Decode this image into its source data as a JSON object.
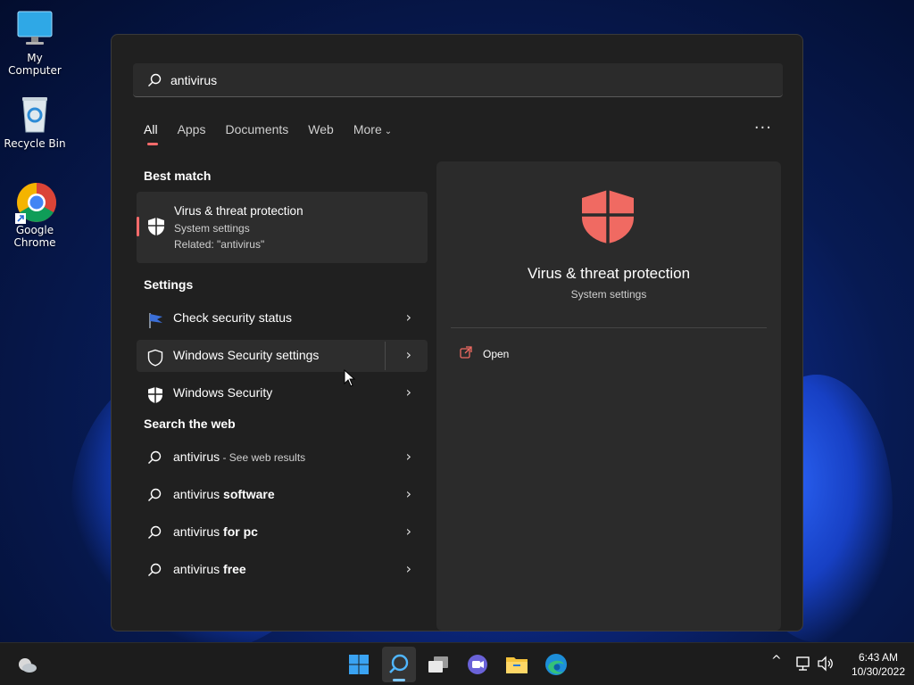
{
  "desktop": {
    "icons": [
      {
        "label": "My Computer"
      },
      {
        "label": "Recycle Bin"
      },
      {
        "label": "Google Chrome"
      }
    ]
  },
  "search": {
    "query": "antivirus",
    "tabs": [
      "All",
      "Apps",
      "Documents",
      "Web",
      "More"
    ],
    "active_tab": "All"
  },
  "best_match": {
    "heading": "Best match",
    "title": "Virus & threat protection",
    "subtitle": "System settings",
    "related": "Related: \"antivirus\""
  },
  "settings": {
    "heading": "Settings",
    "items": [
      {
        "label": "Check security status",
        "icon": "flag-icon"
      },
      {
        "label": "Windows Security settings",
        "icon": "shield-outline-icon"
      },
      {
        "label": "Windows Security",
        "icon": "shield-filled-icon"
      }
    ]
  },
  "web": {
    "heading": "Search the web",
    "items": [
      {
        "prefix": "antivirus",
        "suffix": " - See web results",
        "bold": ""
      },
      {
        "prefix": "antivirus ",
        "bold": "software",
        "suffix": ""
      },
      {
        "prefix": "antivirus ",
        "bold": "for pc",
        "suffix": ""
      },
      {
        "prefix": "antivirus ",
        "bold": "free",
        "suffix": ""
      }
    ]
  },
  "detail": {
    "title": "Virus & threat protection",
    "subtitle": "System settings",
    "action": "Open"
  },
  "taskbar": {
    "time": "6:43 AM",
    "date": "10/30/2022"
  },
  "colors": {
    "accent": "#ff6b6b",
    "panel_bg": "#202020"
  }
}
